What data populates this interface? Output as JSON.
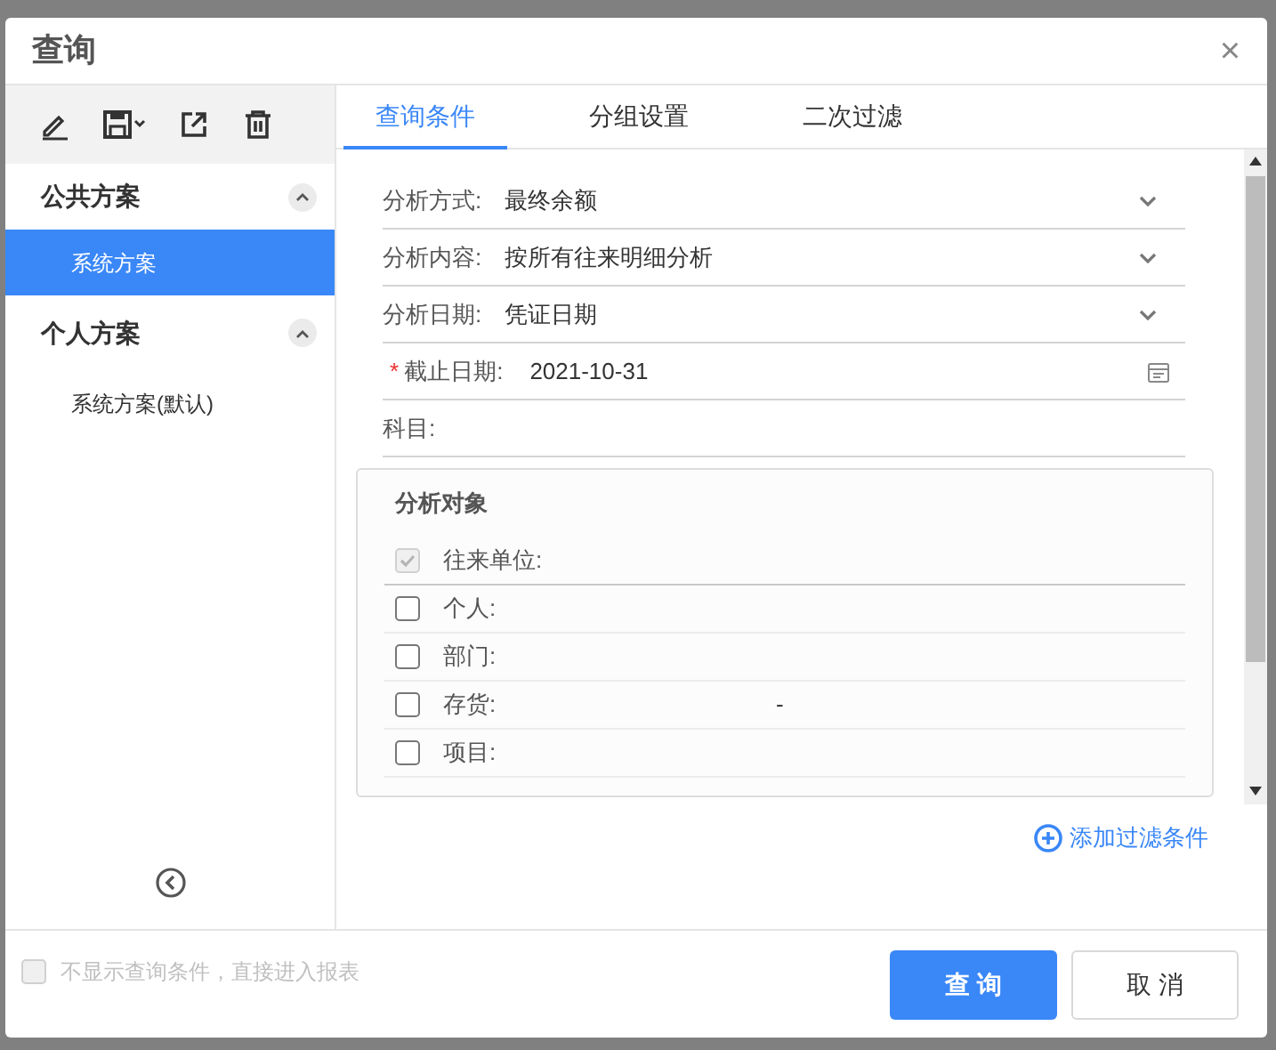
{
  "dialog": {
    "title": "查询",
    "close": "×"
  },
  "sidebar": {
    "groups": [
      {
        "title": "公共方案",
        "expanded": true,
        "items": [
          {
            "label": "系统方案",
            "selected": true
          }
        ]
      },
      {
        "title": "个人方案",
        "expanded": true,
        "items": [
          {
            "label": "系统方案(默认)",
            "selected": false
          }
        ]
      }
    ]
  },
  "tabs": [
    {
      "label": "查询条件",
      "selected": true
    },
    {
      "label": "分组设置",
      "selected": false
    },
    {
      "label": "二次过滤",
      "selected": false
    }
  ],
  "fields": [
    {
      "kind": "select",
      "label": "分析方式:",
      "value": "最终余额"
    },
    {
      "kind": "select",
      "label": "分析内容:",
      "value": "按所有往来明细分析"
    },
    {
      "kind": "select",
      "label": "分析日期:",
      "value": "凭证日期"
    },
    {
      "kind": "date",
      "required_mark": "*",
      "label": "截止日期:",
      "value": "2021-10-31"
    },
    {
      "kind": "text",
      "label": "科目:"
    }
  ],
  "analysis_objects": {
    "title": "分析对象",
    "items": [
      {
        "label": "往来单位:",
        "checked": true,
        "disabled": true
      },
      {
        "label": "个人:",
        "checked": false,
        "disabled": false
      },
      {
        "label": "部门:",
        "checked": false,
        "disabled": false
      },
      {
        "label": "存货:",
        "checked": false,
        "disabled": false,
        "value": "-"
      },
      {
        "label": "项目:",
        "checked": false,
        "disabled": false
      }
    ]
  },
  "add_filter": {
    "label": "添加过滤条件"
  },
  "footer": {
    "skip_option": {
      "label": "不显示查询条件，直接进入报表",
      "checked": false,
      "disabled": true
    },
    "buttons": [
      {
        "label": "查 询",
        "kind": "primary"
      },
      {
        "label": "取 消",
        "kind": "default"
      }
    ]
  }
}
